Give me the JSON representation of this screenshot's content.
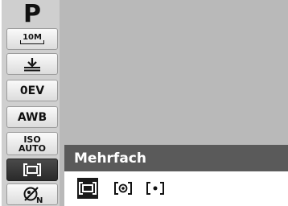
{
  "sidebar": {
    "mode": "P",
    "resolution_label": "10M",
    "ev_label": "0EV",
    "wb_label": "AWB",
    "iso_label_top": "ISO",
    "iso_label_bottom": "AUTO",
    "items": [
      {
        "name": "resolution-icon",
        "selected": false
      },
      {
        "name": "quality-icon",
        "selected": false
      },
      {
        "name": "ev-item",
        "selected": false
      },
      {
        "name": "awb-item",
        "selected": false
      },
      {
        "name": "iso-item",
        "selected": false
      },
      {
        "name": "metering-multi-icon",
        "selected": true
      },
      {
        "name": "color-effect-icon",
        "selected": false
      }
    ]
  },
  "panel": {
    "title": "Mehrfach",
    "options": [
      {
        "icon": "metering-multi-icon",
        "selected": true
      },
      {
        "icon": "metering-center-icon",
        "selected": false
      },
      {
        "icon": "metering-spot-icon",
        "selected": false
      }
    ]
  },
  "colors": {
    "lcd_background": "#b9b9b9",
    "sidebar_background": "#cfcfcf",
    "panel_header": "#5a5a5a",
    "selected": "#2a2a2a"
  }
}
